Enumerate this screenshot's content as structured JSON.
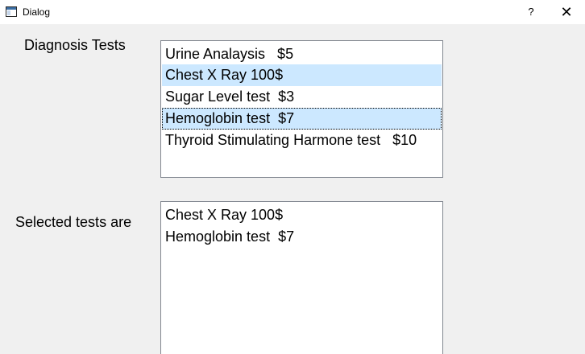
{
  "window": {
    "title": "Dialog",
    "help_label": "?",
    "close_label": "✕"
  },
  "labels": {
    "diagnosis": "Diagnosis Tests",
    "selected": "Selected tests are"
  },
  "diagnosis_list": {
    "items": [
      {
        "label": "Urine Analaysis   $5",
        "selected": false
      },
      {
        "label": "Chest X Ray 100$",
        "selected": true
      },
      {
        "label": "Sugar Level test  $3",
        "selected": false
      },
      {
        "label": "Hemoglobin test  $7",
        "selected": true,
        "focused": true
      },
      {
        "label": "Thyroid Stimulating Harmone test   $10",
        "selected": false
      }
    ]
  },
  "selected_list": {
    "items": [
      {
        "label": "Chest X Ray 100$"
      },
      {
        "label": "Hemoglobin test  $7"
      }
    ]
  },
  "colors": {
    "selection": "#cce8ff",
    "window_bg": "#f0f0f0"
  }
}
